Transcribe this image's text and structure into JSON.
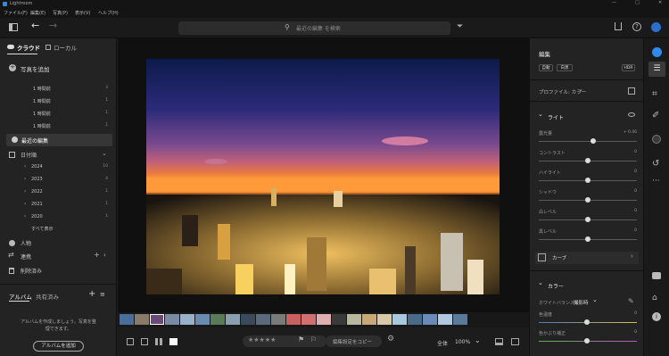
{
  "app": {
    "title": "Lightroom"
  },
  "window_controls": {
    "minimize": "—",
    "maximize": "□",
    "close": "✕"
  },
  "menu": [
    {
      "label": "ファイル(F)"
    },
    {
      "label": "編集(E)"
    },
    {
      "label": "写真(P)"
    },
    {
      "label": "表示(V)"
    },
    {
      "label": "ヘルプ(H)"
    }
  ],
  "toolbar": {
    "search_placeholder": "最近の編集 を検索"
  },
  "left_panel": {
    "tab_cloud": "クラウド",
    "tab_local": "ローカル",
    "add_photos": "写真を追加",
    "recent_items": [
      {
        "label": "1 時間前",
        "count": "3"
      },
      {
        "label": "1 時間前",
        "count": "1"
      },
      {
        "label": "1 時間前",
        "count": "1"
      },
      {
        "label": "1 時間前",
        "count": "1"
      }
    ],
    "recent_edits": "最近の編集",
    "by_date": "日付順",
    "years": [
      {
        "label": "2024",
        "count": "10"
      },
      {
        "label": "2023",
        "count": "4"
      },
      {
        "label": "2022",
        "count": "1"
      },
      {
        "label": "2021",
        "count": "1"
      },
      {
        "label": "2020",
        "count": "1"
      }
    ],
    "show_all": "すべて表示",
    "people": "人物",
    "linked": "連携",
    "deleted": "削除済み",
    "albums_tab": "アルバム",
    "shared_tab": "共有済み",
    "albums_empty_line1": "アルバムを作成しましょう。写真を整",
    "albums_empty_line2": "理できます。",
    "add_album": "アルバムを追加"
  },
  "bottom_bar": {
    "stars": "★★★★★",
    "copy_settings": "編集設定をコピー",
    "fit_label": "全体",
    "zoom": "100%"
  },
  "right_panel": {
    "title": "編集",
    "auto": "自動",
    "bw": "白黒",
    "hdr": "HDR",
    "profile_label": "プロファイル: カラー",
    "light_section": "ライト",
    "sliders": [
      {
        "label": "露光量",
        "value": "+ 0.46",
        "level": 0.55
      },
      {
        "label": "コントラスト",
        "value": "0",
        "level": 0.5
      },
      {
        "label": "ハイライト",
        "value": "0",
        "level": 0.5
      },
      {
        "label": "シャドウ",
        "value": "0",
        "level": 0.5
      },
      {
        "label": "白レベル",
        "value": "0",
        "level": 0.5
      },
      {
        "label": "黒レベル",
        "value": "0",
        "level": 0.5
      }
    ],
    "curve": "カーブ",
    "color_section": "カラー",
    "white_balance_label": "ホワイトバランス",
    "white_balance_value": "撮影時",
    "temp_label": "色温度",
    "temp_value": "0",
    "tint_label": "色かぶり補正",
    "tint_value": "0"
  },
  "colors": {
    "accent": "#2d8ceb",
    "panel": "#232323",
    "main_bg": "#101010"
  }
}
